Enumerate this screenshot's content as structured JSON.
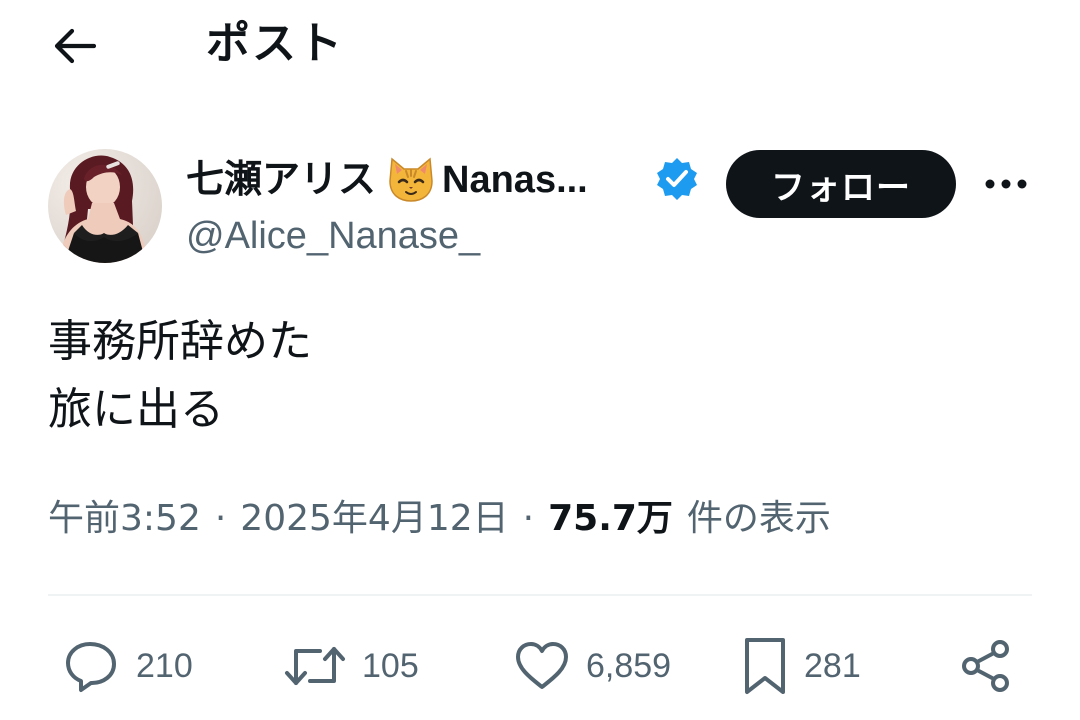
{
  "header": {
    "back_icon": "arrow-left-icon",
    "title": "ポスト"
  },
  "author": {
    "avatar_icon": "profile-photo",
    "display_name_jp": "七瀬アリス",
    "display_name_emoji": "cat-face-emoji",
    "display_name_latin": "Nanas...",
    "verified_icon": "verified-badge-icon",
    "verified_color": "#1d9bf0",
    "handle": "@Alice_Nanase_",
    "follow_label": "フォロー",
    "more_icon": "more-horizontal-icon"
  },
  "post": {
    "lines": [
      "事務所辞めた",
      "旅に出る"
    ],
    "time": "午前3:52",
    "separator": "·",
    "date": "2025年4月12日",
    "views_count": "75.7万",
    "views_label": "件の表示"
  },
  "actions": {
    "reply": {
      "icon": "reply-icon",
      "count": "210"
    },
    "repost": {
      "icon": "repost-icon",
      "count": "105"
    },
    "like": {
      "icon": "heart-icon",
      "count": "6,859"
    },
    "bookmark": {
      "icon": "bookmark-icon",
      "count": "281"
    },
    "share": {
      "icon": "share-icon"
    }
  },
  "colors": {
    "text_primary": "#0f1419",
    "text_secondary": "#536471",
    "background": "#ffffff",
    "divider": "#eff3f4"
  }
}
